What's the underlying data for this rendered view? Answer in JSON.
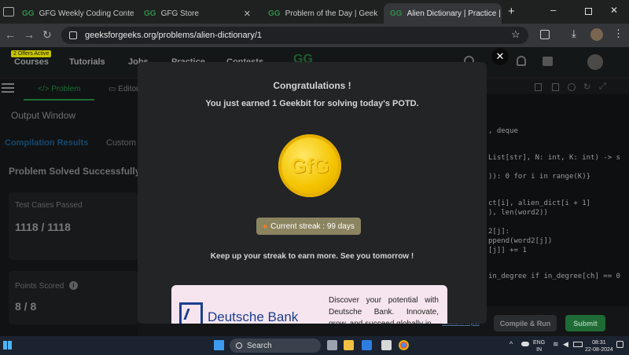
{
  "browser": {
    "tabs": [
      {
        "label": "GFG Weekly Coding Conte"
      },
      {
        "label": "GFG Store"
      },
      {
        "label": "Problem of the Day | Geek"
      },
      {
        "label": "Alien Dictionary | Practice |"
      }
    ],
    "url": "geeksforgeeks.org/problems/alien-dictionary/1"
  },
  "site_nav": {
    "offers_badge": "2 Offers Active",
    "items": [
      "Courses",
      "Tutorials",
      "Jobs",
      "Practice",
      "Contests"
    ]
  },
  "left_panel": {
    "tabs": [
      "Problem",
      "Editor"
    ],
    "output_window": "Output Window",
    "result_tabs": [
      "Compilation Results",
      "Custom"
    ],
    "status": "Problem Solved Successfully",
    "test_cases_label": "Test Cases Passed",
    "test_cases_value": "1118 / 1118",
    "points_label": "Points Scored",
    "points_value": "8 / 8"
  },
  "code_lines": [
    ", deque",
    "List[str], N: int, K: int) -> s",
    ")): 0 for i in range(K)}",
    "ct[i], alien_dict[i + 1]",
    "), len(word2))",
    "2[j]:",
    "ppend(word2[j])",
    "[j]] += 1",
    "in_degree if in_degree[ch] == 0"
  ],
  "modal": {
    "title": "Congratulations !",
    "message": "You just earned 1 Geekbit for solving today's POTD.",
    "coin_logo": "GfG",
    "streak": "Current streak : 99 days",
    "footer": "Keep up your streak to earn more. See you tomorrow !",
    "ad_brand": "Deutsche Bank",
    "ad_text": "Discover your potential with Deutsche Bank. Innovate, grow, and succeed globally in"
  },
  "editor_buttons": {
    "custom_input": "Custom Input",
    "compile": "Compile & Run",
    "submit": "Submit"
  },
  "taskbar": {
    "search": "Search",
    "lang": "ENG",
    "region": "IN",
    "time": "08:31",
    "date": "22-08-2024"
  },
  "colors": {
    "gfg_green": "#2f8d46",
    "coin": "#f4c400",
    "submit": "#1e6b35"
  }
}
